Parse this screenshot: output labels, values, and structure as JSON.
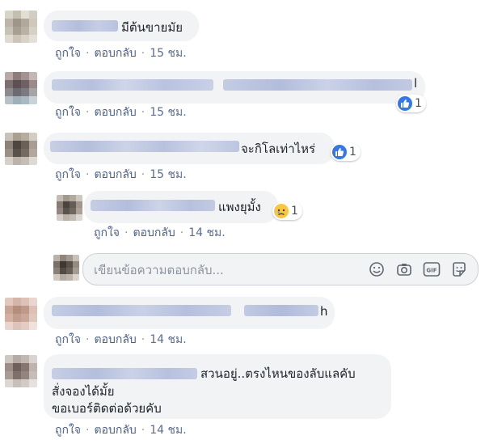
{
  "comments": [
    {
      "text_lines": [
        "มีต้นขายมัย"
      ],
      "actions": {
        "like": "ถูกใจ",
        "reply": "ตอบกลับ",
        "time": "15 ชม."
      }
    },
    {
      "text_lines": [
        "l"
      ],
      "reaction": {
        "icon": "like-icon",
        "count": "1"
      },
      "actions": {
        "like": "ถูกใจ",
        "reply": "ตอบกลับ",
        "time": "15 ชม."
      }
    },
    {
      "text_lines": [
        "จะกิโลเท่าไหร่"
      ],
      "reaction": {
        "icon": "like-icon",
        "count": "1"
      },
      "actions": {
        "like": "ถูกใจ",
        "reply": "ตอบกลับ",
        "time": "15 ชม."
      }
    },
    {
      "text_lines": [
        "แพงยุมั้ง"
      ],
      "reaction": {
        "icon": "sad-icon",
        "count": "1"
      },
      "actions": {
        "like": "ถูกใจ",
        "reply": "ตอบกลับ",
        "time": "14 ชม."
      }
    },
    {
      "text_lines": [
        "h"
      ],
      "actions": {
        "like": "ถูกใจ",
        "reply": "ตอบกลับ",
        "time": "14 ชม."
      }
    },
    {
      "text_lines": [
        "สวนอยู่..ตรงไหนของลับแลคับ",
        "สั่งจองได้มั้ย",
        "ขอเบอร์ติดต่อด้วยคับ"
      ],
      "actions": {
        "like": "ถูกใจ",
        "reply": "ตอบกลับ",
        "time": "14 ชม."
      }
    }
  ],
  "reply_box": {
    "placeholder": "เขียนข้อความตอบกลับ...",
    "icons": [
      "emoji-icon",
      "camera-icon",
      "gif-icon",
      "sticker-icon"
    ],
    "gif_label": "GIF"
  },
  "colors": {
    "bubble": "#f2f3f5",
    "link": "#4b5f86",
    "like_blue": "#3578e5"
  }
}
